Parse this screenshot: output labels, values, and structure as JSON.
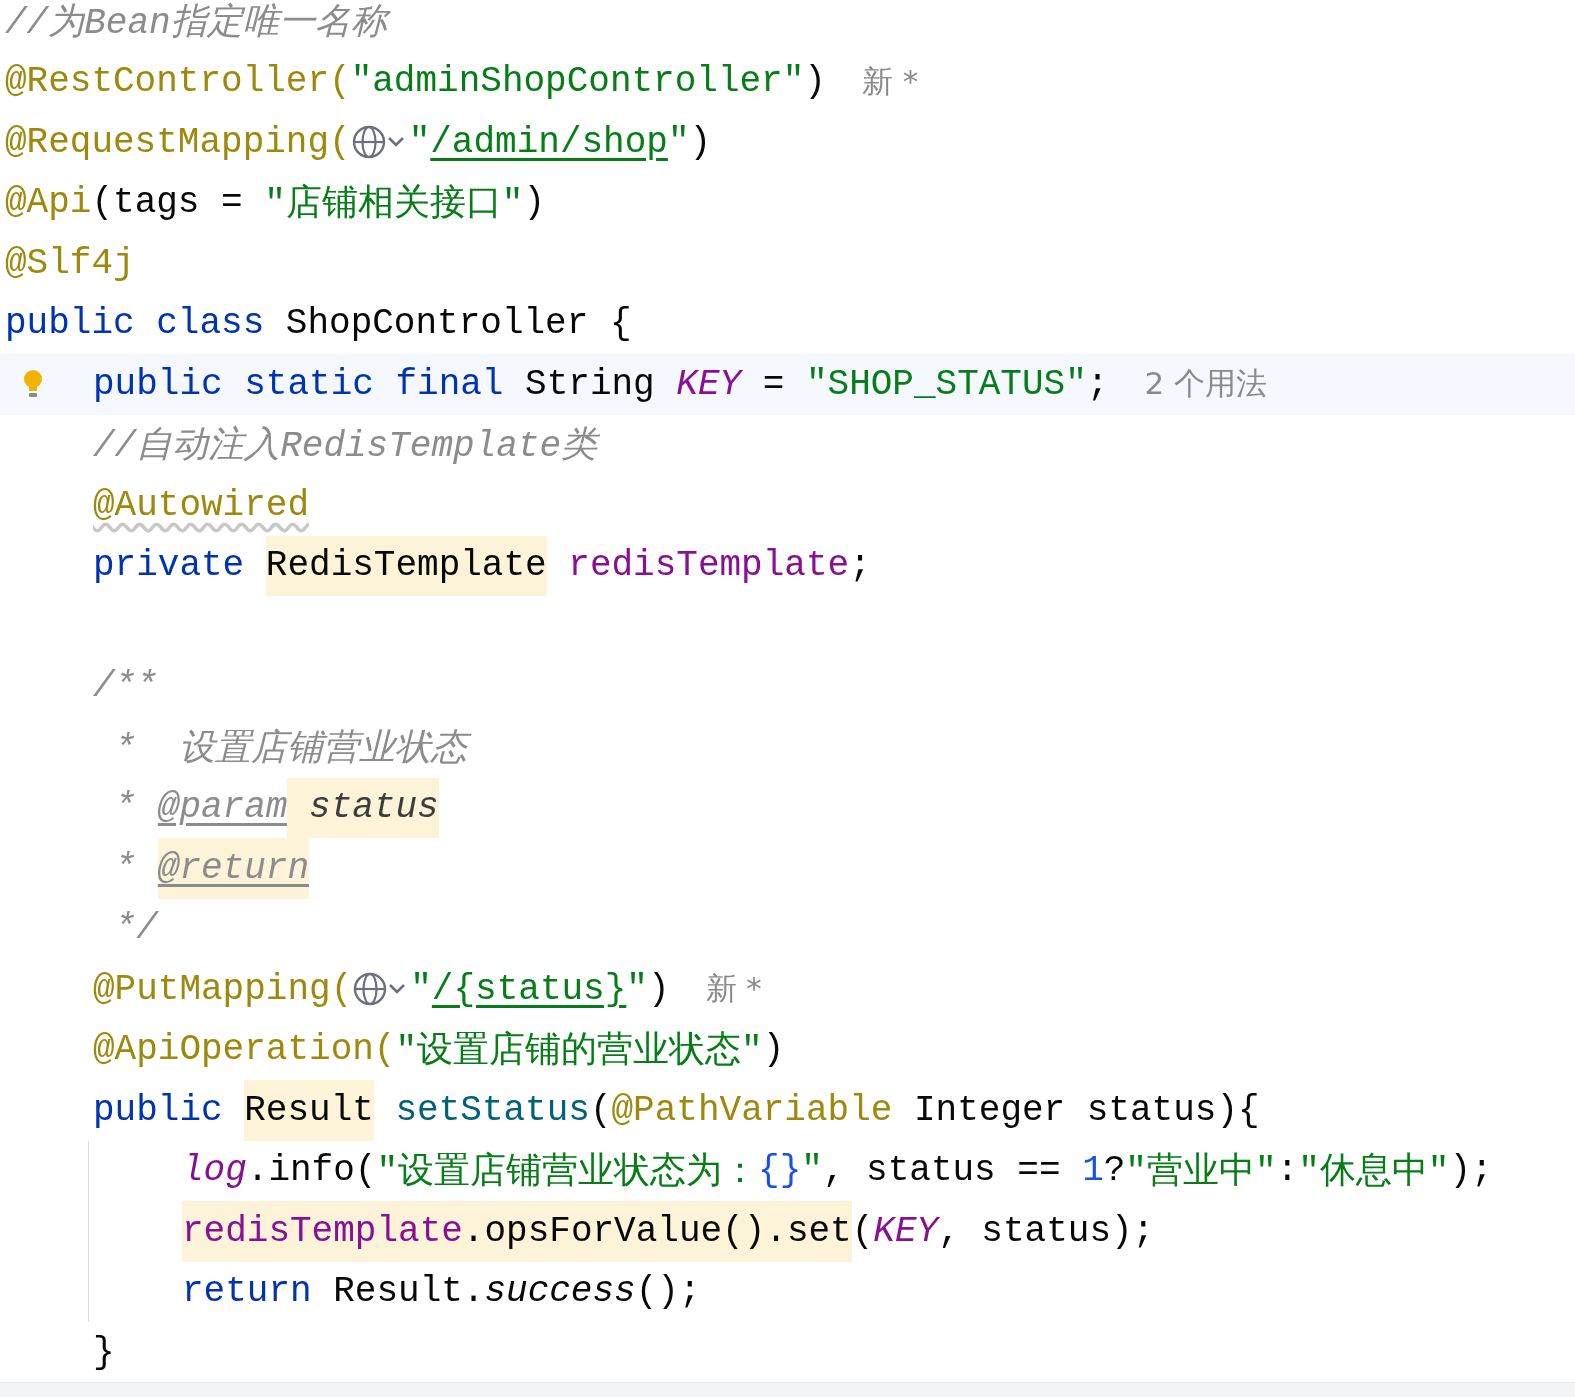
{
  "lines": [
    {
      "tokens": [
        {
          "text": "//为Bean指定唯一名称",
          "kind": "comment",
          "marked": false
        }
      ],
      "current": false
    },
    {
      "tokens": [
        {
          "text": "@RestController(",
          "kind": "annotation",
          "marked": false
        },
        {
          "text": "\"adminShopController\"",
          "kind": "string",
          "marked": false
        },
        {
          "text": ")",
          "kind": "plain",
          "marked": false
        },
        {
          "text": "新 *",
          "kind": "hint",
          "marked": false
        }
      ],
      "current": false
    },
    {
      "tokens": [
        {
          "text": "@RequestMapping(",
          "kind": "annotation",
          "marked": false
        },
        {
          "kind": "globe",
          "marked": false
        },
        {
          "text": "\"",
          "kind": "string",
          "marked": false
        },
        {
          "text": "/admin/shop",
          "kind": "link",
          "marked": false
        },
        {
          "text": "\"",
          "kind": "string",
          "marked": false
        },
        {
          "text": ")",
          "kind": "plain",
          "marked": false
        }
      ],
      "current": false
    },
    {
      "tokens": [
        {
          "text": "@Api",
          "kind": "annotation",
          "marked": false
        },
        {
          "text": "(tags = ",
          "kind": "plain",
          "marked": false
        },
        {
          "text": "\"店铺相关接口\"",
          "kind": "string",
          "marked": false
        },
        {
          "text": ")",
          "kind": "plain",
          "marked": false
        }
      ],
      "current": false
    },
    {
      "tokens": [
        {
          "text": "@Slf4j",
          "kind": "annotation",
          "marked": false
        }
      ],
      "current": false
    },
    {
      "tokens": [
        {
          "text": "public class",
          "kind": "keyword",
          "marked": false
        },
        {
          "text": " ShopController {",
          "kind": "plain",
          "marked": false
        }
      ],
      "current": false,
      "children": [
        {
          "tokens": [
            {
              "text": "public static final",
              "kind": "keyword",
              "marked": false
            },
            {
              "text": " String ",
              "kind": "plain",
              "marked": false
            },
            {
              "text": "KEY",
              "kind": "static",
              "marked": false
            },
            {
              "text": " = ",
              "kind": "plain",
              "marked": false
            },
            {
              "text": "\"SHOP_STATUS\"",
              "kind": "string",
              "marked": false
            },
            {
              "text": ";",
              "kind": "plain",
              "marked": false
            },
            {
              "text": "2 个用法",
              "kind": "hint",
              "marked": false
            }
          ],
          "current": true
        },
        {
          "tokens": [
            {
              "text": "//自动注入RedisTemplate类",
              "kind": "comment",
              "marked": false
            }
          ],
          "current": false
        },
        {
          "tokens": [
            {
              "text": "@Autowired",
              "kind": "warned",
              "marked": false
            }
          ],
          "current": false
        },
        {
          "tokens": [
            {
              "text": "private ",
              "kind": "keyword",
              "marked": false
            },
            {
              "text": "RedisTemplate",
              "kind": "plain",
              "marked": true
            },
            {
              "text": " redisTemplate",
              "kind": "field",
              "marked": false
            },
            {
              "text": ";",
              "kind": "plain",
              "marked": false
            }
          ],
          "current": false
        },
        {
          "current": false
        },
        {
          "tokens": [
            {
              "text": "/**",
              "kind": "doc",
              "marked": false
            }
          ],
          "current": false
        },
        {
          "tokens": [
            {
              "text": " *  设置店铺营业状态",
              "kind": "doc",
              "marked": false
            }
          ],
          "current": false
        },
        {
          "tokens": [
            {
              "text": " * ",
              "kind": "doc",
              "marked": false
            },
            {
              "text": "@param",
              "kind": "doctag",
              "marked": false
            },
            {
              "text": " status",
              "kind": "docparam",
              "marked": true
            }
          ],
          "current": false
        },
        {
          "tokens": [
            {
              "text": " * ",
              "kind": "doc",
              "marked": false
            },
            {
              "text": "@return",
              "kind": "doctag",
              "marked": true
            }
          ],
          "current": false
        },
        {
          "tokens": [
            {
              "text": " */",
              "kind": "doc",
              "marked": false
            }
          ],
          "current": false
        },
        {
          "tokens": [
            {
              "text": "@PutMapping(",
              "kind": "annotation",
              "marked": false
            },
            {
              "kind": "globe",
              "marked": false
            },
            {
              "text": "\"",
              "kind": "string",
              "marked": false
            },
            {
              "text": "/{status}",
              "kind": "link",
              "marked": false
            },
            {
              "text": "\"",
              "kind": "string",
              "marked": false
            },
            {
              "text": ")",
              "kind": "plain",
              "marked": false
            },
            {
              "text": "新 *",
              "kind": "hint",
              "marked": false
            }
          ],
          "current": false
        },
        {
          "tokens": [
            {
              "text": "@ApiOperation(",
              "kind": "annotation",
              "marked": false
            },
            {
              "text": "\"设置店铺的营业状态\"",
              "kind": "string",
              "marked": false
            },
            {
              "text": ")",
              "kind": "plain",
              "marked": false
            }
          ],
          "current": false
        },
        {
          "tokens": [
            {
              "text": "public ",
              "kind": "keyword",
              "marked": false
            },
            {
              "text": "Result",
              "kind": "plain",
              "marked": true
            },
            {
              "text": " setStatus",
              "kind": "method",
              "marked": false
            },
            {
              "text": "(",
              "kind": "plain",
              "marked": false
            },
            {
              "text": "@PathVariable",
              "kind": "annotation",
              "marked": false
            },
            {
              "text": " Integer status){",
              "kind": "plain",
              "marked": false
            }
          ],
          "current": false,
          "children": [
            {
              "tokens": [
                {
                  "text": "log",
                  "kind": "static",
                  "marked": false
                },
                {
                  "text": ".info(",
                  "kind": "plain",
                  "marked": false
                },
                {
                  "text": "\"设置店铺营业状态为：",
                  "kind": "string",
                  "marked": false
                },
                {
                  "text": "{}",
                  "kind": "number",
                  "marked": false
                },
                {
                  "text": "\"",
                  "kind": "string",
                  "marked": false
                },
                {
                  "text": ", status == ",
                  "kind": "plain",
                  "marked": false
                },
                {
                  "text": "1",
                  "kind": "number",
                  "marked": false
                },
                {
                  "text": "?",
                  "kind": "plain",
                  "marked": false
                },
                {
                  "text": "\"营业中\"",
                  "kind": "string",
                  "marked": false
                },
                {
                  "text": ":",
                  "kind": "plain",
                  "marked": false
                },
                {
                  "text": "\"休息中\"",
                  "kind": "string",
                  "marked": false
                },
                {
                  "text": ");",
                  "kind": "plain",
                  "marked": false
                }
              ],
              "current": false
            },
            {
              "tokens": [
                {
                  "text": "redisTemplate",
                  "kind": "field",
                  "marked": true
                },
                {
                  "text": ".opsForValue().set",
                  "kind": "plain",
                  "marked": true
                },
                {
                  "text": "(",
                  "kind": "plain",
                  "marked": false
                },
                {
                  "text": "KEY",
                  "kind": "static",
                  "marked": false
                },
                {
                  "text": ", status);",
                  "kind": "plain",
                  "marked": false
                }
              ],
              "current": false
            },
            {
              "tokens": [
                {
                  "text": "return",
                  "kind": "keyword",
                  "marked": false
                },
                {
                  "text": " Result.",
                  "kind": "plain",
                  "marked": false
                },
                {
                  "text": "success",
                  "kind": "italic",
                  "marked": false
                },
                {
                  "text": "();",
                  "kind": "plain",
                  "marked": false
                }
              ],
              "current": false
            }
          ]
        },
        {
          "tokens": [
            {
              "text": "}",
              "kind": "plain",
              "marked": false
            }
          ],
          "current": false
        }
      ]
    }
  ]
}
